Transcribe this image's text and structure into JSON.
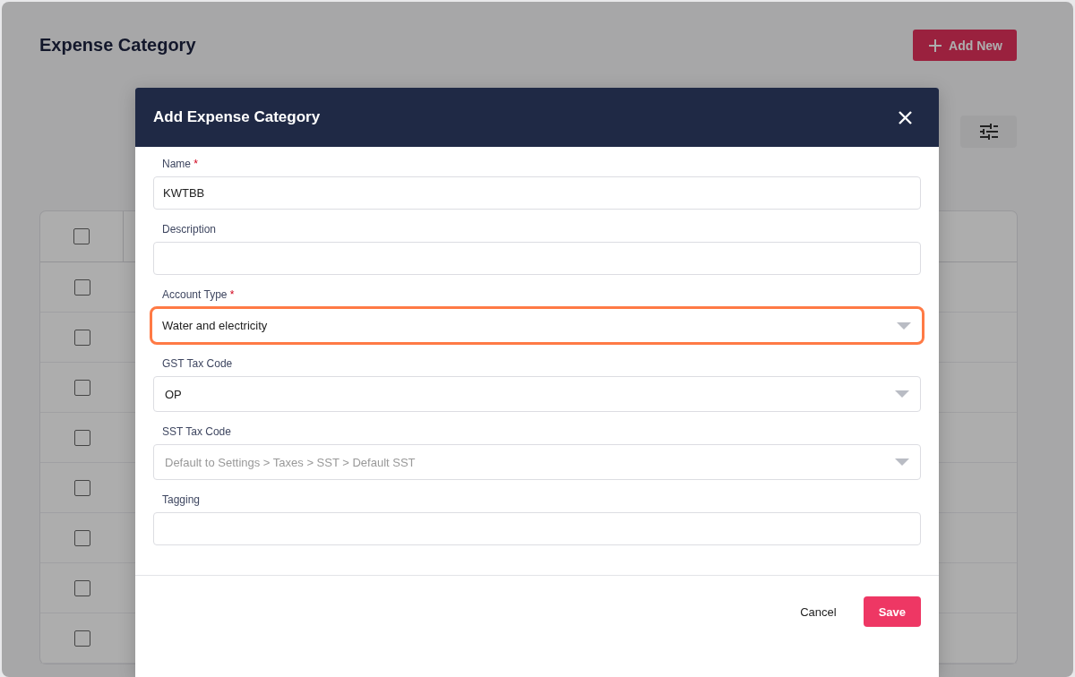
{
  "page": {
    "title": "Expense Category",
    "add_button": "Add New"
  },
  "table": {
    "header_checkbox": {
      "checked": false
    },
    "rows": [
      {
        "checked": false
      },
      {
        "checked": false
      },
      {
        "checked": false
      },
      {
        "checked": false
      },
      {
        "checked": false
      },
      {
        "checked": false
      },
      {
        "checked": false
      },
      {
        "checked": false
      }
    ]
  },
  "dialog": {
    "title": "Add Expense Category",
    "fields": [
      {
        "kind": "text",
        "label": "Name",
        "required_mark": "*",
        "value": "KWTBB",
        "highlighted": false
      },
      {
        "kind": "text",
        "label": "Description",
        "highlighted": false
      },
      {
        "kind": "select",
        "label": "Account Type",
        "required_mark": "*",
        "value": "Water and electricity",
        "highlighted": true
      },
      {
        "kind": "select",
        "label": "GST Tax Code",
        "value": "OP",
        "highlighted": false
      },
      {
        "kind": "select",
        "label": "SST Tax Code",
        "placeholder": "Default to Settings > Taxes > SST > Default SST",
        "highlighted": false
      },
      {
        "kind": "text",
        "label": "Tagging",
        "highlighted": false
      }
    ],
    "buttons": [
      {
        "kind": "text",
        "label": "Cancel"
      },
      {
        "kind": "primary",
        "label": "Save"
      }
    ]
  }
}
